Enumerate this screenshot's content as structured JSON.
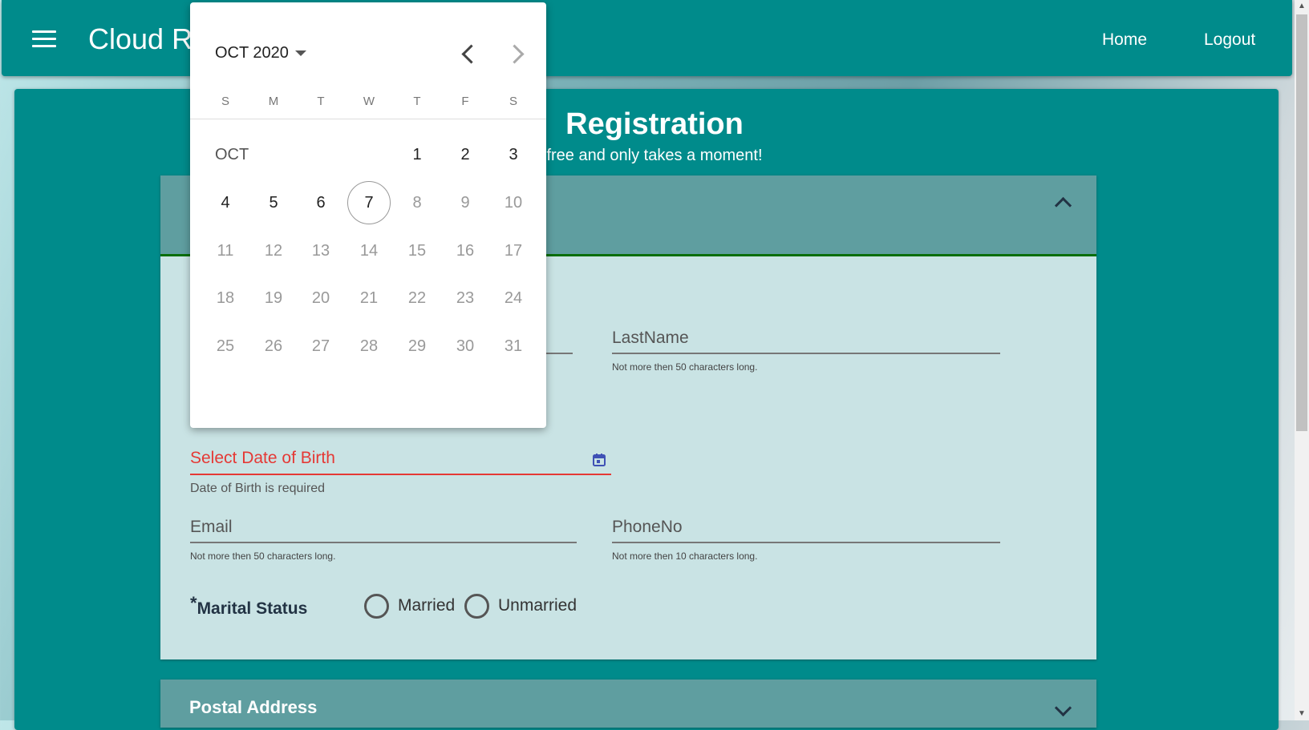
{
  "toolbar": {
    "title": "Cloud R",
    "home": "Home",
    "logout": "Logout"
  },
  "registration": {
    "title": "Registration",
    "subtitle": "free and only takes a moment!"
  },
  "form": {
    "lastname": {
      "label": "LastName",
      "hint": "Not more then 50 characters long."
    },
    "dob": {
      "label": "Select Date of Birth",
      "error": "Date of Birth is required"
    },
    "email": {
      "label": "Email",
      "hint": "Not more then 50 characters long."
    },
    "phone": {
      "label": "PhoneNo",
      "hint": "Not more then 10 characters long."
    },
    "marital": {
      "asterisk": "*",
      "label": "Marital Status",
      "options": [
        "Married",
        "Unmarried"
      ]
    }
  },
  "postal": {
    "title": "Postal Address"
  },
  "datepicker": {
    "month_year": "OCT 2020",
    "month_label": "OCT",
    "weekdays": [
      "S",
      "M",
      "T",
      "W",
      "T",
      "F",
      "S"
    ],
    "days": [
      "1",
      "2",
      "3",
      "4",
      "5",
      "6",
      "7",
      "8",
      "9",
      "10",
      "11",
      "12",
      "13",
      "14",
      "15",
      "16",
      "17",
      "18",
      "19",
      "20",
      "21",
      "22",
      "23",
      "24",
      "25",
      "26",
      "27",
      "28",
      "29",
      "30",
      "31"
    ],
    "today": 7,
    "last_enabled": 7,
    "first_weekday": 4
  },
  "icons": {
    "menu": "menu-icon",
    "calendar": "calendar-icon",
    "chevron_up": "chevron-up-icon",
    "chevron_down": "chevron-down-icon"
  },
  "colors": {
    "primary": "#008b8b",
    "panel_header": "#5f9ea0",
    "panel_body": "#c9e3e4",
    "error": "#e53935"
  }
}
